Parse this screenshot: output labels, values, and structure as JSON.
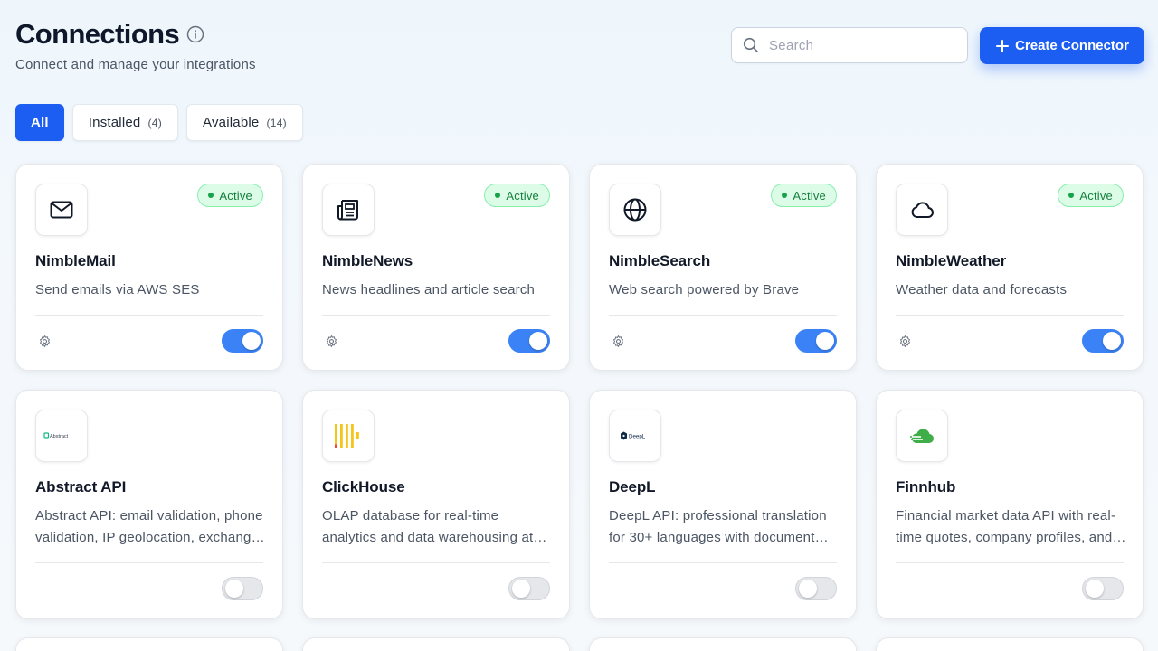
{
  "header": {
    "title": "Connections",
    "subtitle": "Connect and manage your integrations",
    "search_placeholder": "Search",
    "search_value": "",
    "create_label": "Create Connector"
  },
  "tabs": [
    {
      "label": "All",
      "count": "",
      "active": true
    },
    {
      "label": "Installed",
      "count": "(4)",
      "active": false
    },
    {
      "label": "Available",
      "count": "(14)",
      "active": false
    }
  ],
  "cards": [
    {
      "name": "NimbleMail",
      "description": "Send emails via AWS SES",
      "status": "Active",
      "enabled": true,
      "icon": "mail-icon",
      "settings": true
    },
    {
      "name": "NimbleNews",
      "description": "News headlines and article search",
      "status": "Active",
      "enabled": true,
      "icon": "newspaper-icon",
      "settings": true
    },
    {
      "name": "NimbleSearch",
      "description": "Web search powered by Brave",
      "status": "Active",
      "enabled": true,
      "icon": "globe-icon",
      "settings": true
    },
    {
      "name": "NimbleWeather",
      "description": "Weather data and forecasts",
      "status": "Active",
      "enabled": true,
      "icon": "cloud-icon",
      "settings": true
    },
    {
      "name": "Abstract API",
      "description": "Abstract API: email validation, phone validation, IP geolocation, exchange rates and more",
      "status": "",
      "enabled": false,
      "icon": "abstract-logo",
      "logo_text": "Abstract",
      "settings": false
    },
    {
      "name": "ClickHouse",
      "description": "OLAP database for real-time analytics and data warehousing at scale",
      "status": "",
      "enabled": false,
      "icon": "clickhouse-logo",
      "settings": false
    },
    {
      "name": "DeepL",
      "description": "DeepL API: professional translation for 30+ languages with document translation",
      "status": "",
      "enabled": false,
      "icon": "deepl-logo",
      "logo_text": "DeepL",
      "settings": false
    },
    {
      "name": "Finnhub",
      "description": "Financial market data API with real-time quotes, company profiles, and more",
      "status": "",
      "enabled": false,
      "icon": "finnhub-logo",
      "settings": false
    }
  ],
  "colors": {
    "accent": "#1d5ef2",
    "toggle_on": "#3b82f6",
    "active_badge_bg": "#dcfce7",
    "active_badge_text": "#15803d",
    "finnhub_green": "#3fae49",
    "clickhouse_yellow": "#f5c518"
  }
}
